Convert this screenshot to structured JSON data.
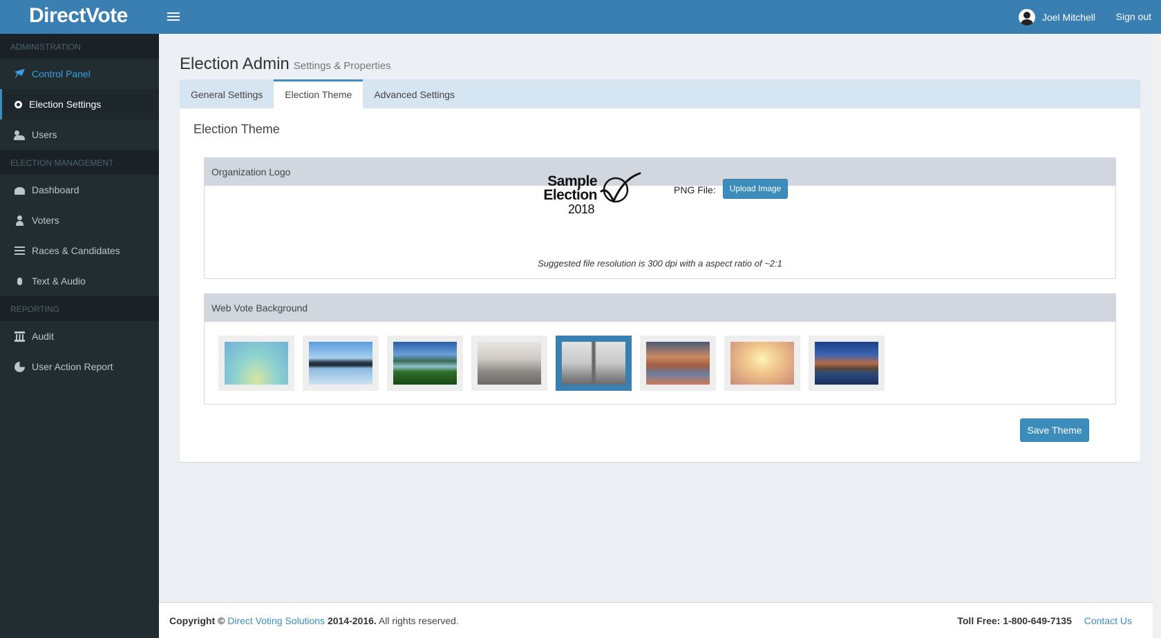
{
  "header": {
    "brand": "DirectVote",
    "user_name": "Joel Mitchell",
    "sign_out": "Sign out"
  },
  "sidebar": {
    "sections": [
      {
        "header": "ADMINISTRATION",
        "items": [
          {
            "label": "Control Panel",
            "icon": "rocket-icon"
          },
          {
            "label": "Election Settings",
            "icon": "gears-icon"
          },
          {
            "label": "Users",
            "icon": "users-icon"
          }
        ]
      },
      {
        "header": "ELECTION MANAGEMENT",
        "items": [
          {
            "label": "Dashboard",
            "icon": "dashboard-icon"
          },
          {
            "label": "Voters",
            "icon": "user-icon"
          },
          {
            "label": "Races & Candidates",
            "icon": "sliders-icon"
          },
          {
            "label": "Text & Audio",
            "icon": "microphone-icon"
          }
        ]
      },
      {
        "header": "REPORTING",
        "items": [
          {
            "label": "Audit",
            "icon": "bank-icon"
          },
          {
            "label": "User Action Report",
            "icon": "pie-chart-icon"
          }
        ]
      }
    ]
  },
  "page": {
    "title": "Election Admin",
    "subtitle": "Settings & Properties",
    "tabs": [
      {
        "label": "General Settings"
      },
      {
        "label": "Election Theme"
      },
      {
        "label": "Advanced Settings"
      }
    ],
    "section_title": "Election Theme",
    "logo_panel": {
      "heading": "Organization Logo",
      "logo_line1": "Sample Election",
      "logo_line2": "2018",
      "png_label": "PNG File:",
      "upload_button": "Upload Image",
      "hint": "Suggested file resolution is 300 dpi with a aspect ratio of ~2:1"
    },
    "background_panel": {
      "heading": "Web Vote Background",
      "backgrounds": [
        "gradient-teal",
        "mountain-lake",
        "forest-valley",
        "city-haze",
        "skyscraper-city",
        "night-street",
        "warm-blur",
        "harbor-town"
      ],
      "selected": "skyscraper-city"
    },
    "save_button": "Save Theme"
  },
  "footer": {
    "copyright_prefix": "Copyright ©",
    "company_link": "Direct Voting Solutions",
    "years": "2014-2016.",
    "rights": "All rights reserved.",
    "toll_free": "Toll Free: 1-800-649-7135",
    "contact": "Contact Us"
  },
  "colors": {
    "header": "#3a7fb1",
    "sidebar": "#222d32",
    "accent": "#3c8dbc"
  }
}
